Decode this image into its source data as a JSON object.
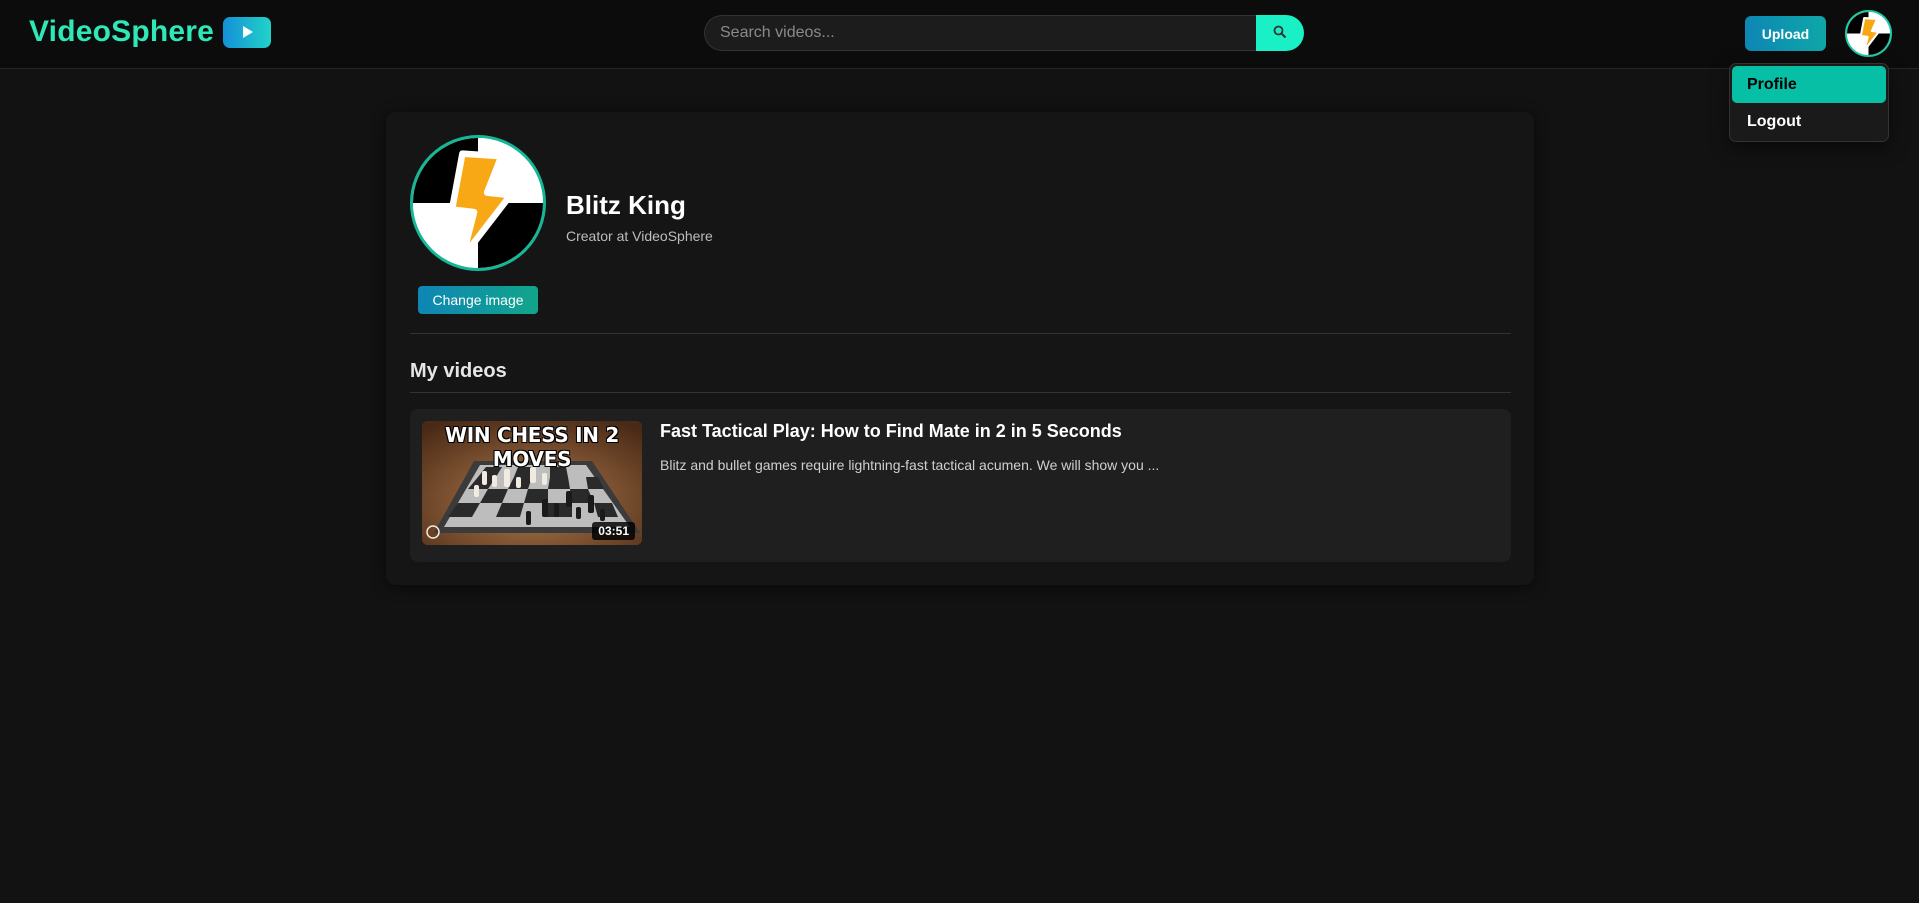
{
  "header": {
    "brand": "VideoSphere",
    "search_placeholder": "Search videos...",
    "upload_label": "Upload"
  },
  "user_menu": {
    "items": [
      {
        "label": "Profile",
        "active": true
      },
      {
        "label": "Logout",
        "active": false
      }
    ]
  },
  "profile": {
    "name": "Blitz King",
    "subtitle": "Creator at VideoSphere",
    "change_image_label": "Change image"
  },
  "videos_section": {
    "title": "My videos",
    "items": [
      {
        "thumbnail_text": "WIN CHESS IN 2 MOVES",
        "duration": "03:51",
        "title": "Fast Tactical Play: How to Find Mate in 2 in 5 Seconds",
        "description": "Blitz and bullet games require lightning-fast tactical acumen. We will show you ..."
      }
    ]
  },
  "colors": {
    "accent": "#2ee8b8",
    "active_menu": "#07bfa5",
    "background": "#121212",
    "card": "#151515"
  }
}
